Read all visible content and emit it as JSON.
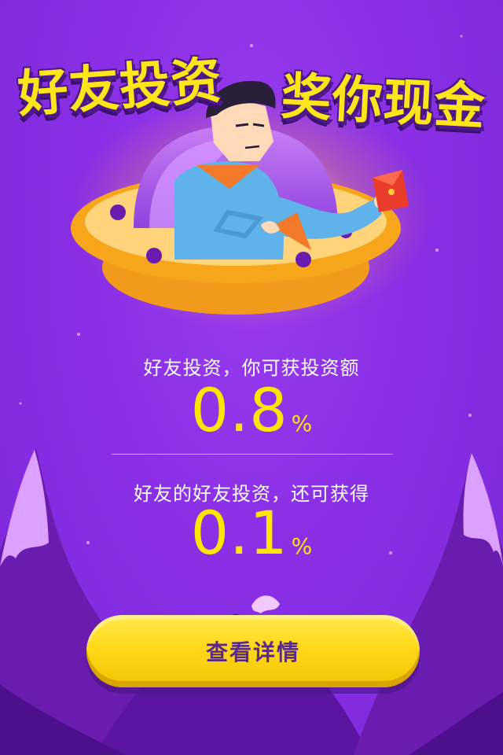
{
  "headline": {
    "left": "好友投资",
    "right": "奖你现金"
  },
  "reward_primary": {
    "label": "好友投资，你可获投资额",
    "value": "0.8",
    "unit": "%"
  },
  "reward_secondary": {
    "label": "好友的好友投资，还可获得",
    "value": "0.1",
    "unit": "%"
  },
  "cta": {
    "label": "查看详情"
  },
  "colors": {
    "background": "#8a2fe6",
    "accent_yellow": "#ffe600",
    "button_text": "#5a2a8a",
    "ufo_orange": "#f7a51b"
  },
  "icons": [
    "ufo-illustration",
    "hero-character",
    "red-envelope-icon",
    "mountain-scenery"
  ]
}
